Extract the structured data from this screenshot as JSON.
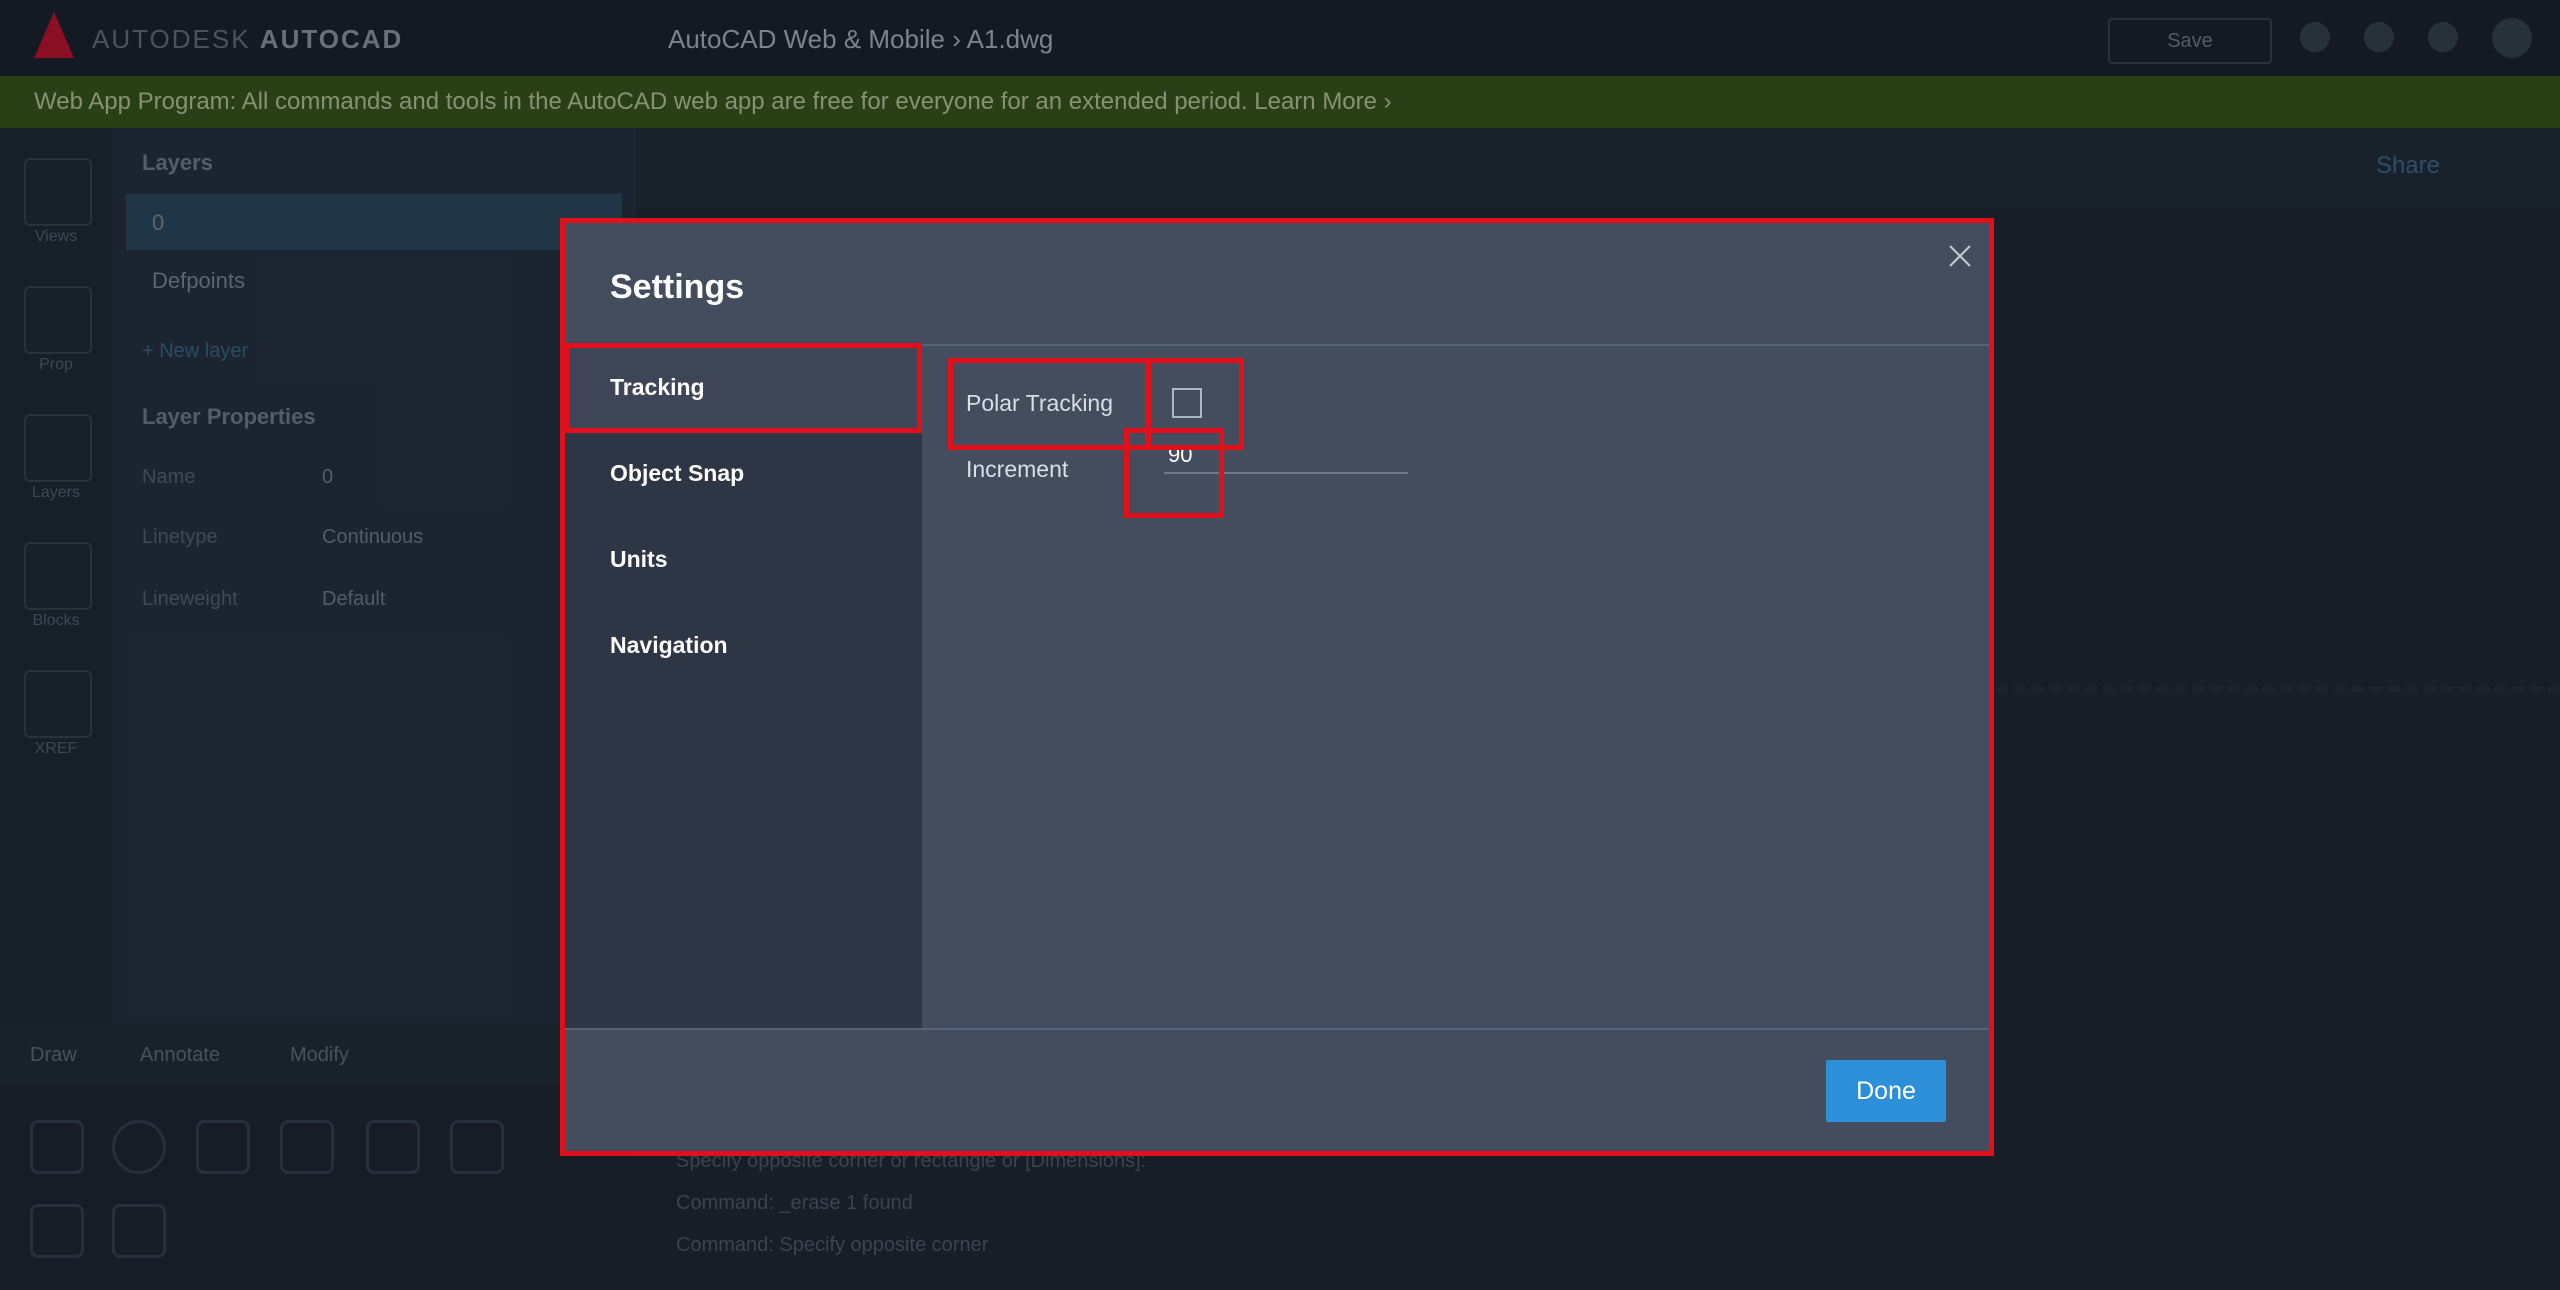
{
  "app": {
    "brand_prefix": "AUTODESK",
    "brand_name": "AUTOCAD",
    "breadcrumb": "AutoCAD Web & Mobile  ›  A1.dwg",
    "save_label": "Save"
  },
  "banner": {
    "text": "Web App Program: All commands and tools in the AutoCAD web app are free for everyone for an extended period.  Learn More ›"
  },
  "left_rail": [
    "Views",
    "Prop",
    "Layers",
    "Blocks",
    "XREF"
  ],
  "layers_panel": {
    "title": "Layers",
    "rows": [
      "0",
      "Defpoints"
    ],
    "new_layer": "+  New layer",
    "props_title": "Layer Properties",
    "props": [
      {
        "label": "Name",
        "value": "0"
      },
      {
        "label": "Linetype",
        "value": "Continuous"
      },
      {
        "label": "Lineweight",
        "value": "Default"
      }
    ]
  },
  "bottom_tabs": [
    "Draw",
    "Annotate",
    "Modify"
  ],
  "canvas": {
    "share_label": "Share",
    "command_lines": [
      "Specify opposite corner or rectangle or [Dimensions]:",
      "Command: _erase 1 found",
      "Command: Specify opposite corner"
    ]
  },
  "dialog": {
    "title": "Settings",
    "nav": [
      "Tracking",
      "Object Snap",
      "Units",
      "Navigation"
    ],
    "active_nav": "Tracking",
    "polar_tracking_label": "Polar Tracking",
    "polar_tracking_checked": false,
    "increment_label": "Increment",
    "increment_value": "90",
    "done_label": "Done"
  }
}
